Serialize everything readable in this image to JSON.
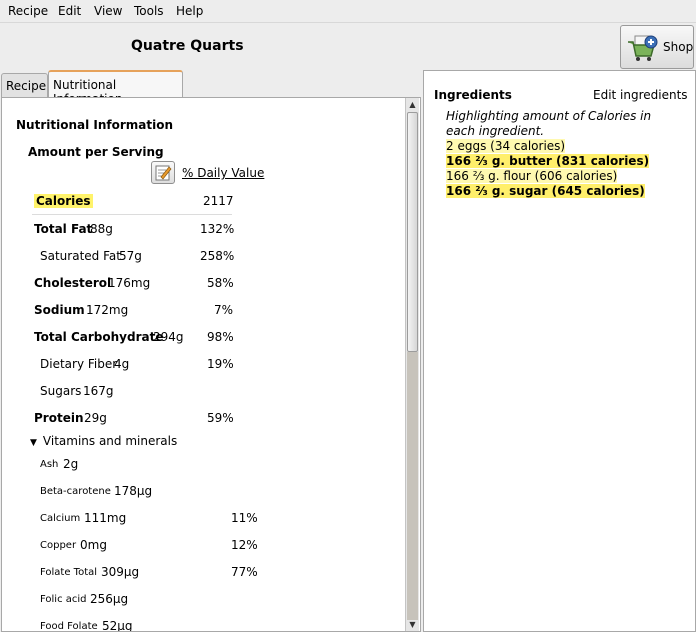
{
  "menubar": {
    "items": [
      "Recipe",
      "Edit",
      "View",
      "Tools",
      "Help"
    ]
  },
  "recipe_title": "Quatre Quarts",
  "shop_button": {
    "label": "Shop",
    "icon": "shopping-cart-icon"
  },
  "tabs": [
    {
      "label": "Recipe",
      "selected": false
    },
    {
      "label": "Nutritional Information",
      "selected": true
    }
  ],
  "nutrition": {
    "heading": "Nutritional Information",
    "amount_label": "Amount per Serving",
    "daily_value_header": "% Daily Value",
    "rows": [
      {
        "name": "Calories",
        "amount": "",
        "dv": "2117"
      },
      {
        "name": "Total Fat",
        "amount": "88g",
        "dv": "132%"
      },
      {
        "name": "Saturated Fat",
        "amount": "57g",
        "dv": "258%"
      },
      {
        "name": "Cholesterol",
        "amount": "176mg",
        "dv": "58%"
      },
      {
        "name": "Sodium",
        "amount": "172mg",
        "dv": "7%"
      },
      {
        "name": "Total Carbohydrate",
        "amount": "294g",
        "dv": "98%"
      },
      {
        "name": "Dietary Fiber",
        "amount": "4g",
        "dv": "19%"
      },
      {
        "name": "Sugars",
        "amount": "167g",
        "dv": ""
      },
      {
        "name": "Protein",
        "amount": "29g",
        "dv": "59%"
      }
    ],
    "vitamins_label": "Vitamins and minerals",
    "vitamins": [
      {
        "name": "Ash",
        "amount": "2g",
        "dv": ""
      },
      {
        "name": "Beta-carotene",
        "amount": "178μg",
        "dv": ""
      },
      {
        "name": "Calcium",
        "amount": "111mg",
        "dv": "11%"
      },
      {
        "name": "Copper",
        "amount": "0mg",
        "dv": "12%"
      },
      {
        "name": "Folate Total",
        "amount": "309μg",
        "dv": "77%"
      },
      {
        "name": "Folic acid",
        "amount": "256μg",
        "dv": ""
      },
      {
        "name": "Food Folate",
        "amount": "52μg",
        "dv": ""
      }
    ]
  },
  "ingredients": {
    "heading": "Ingredients",
    "edit_label": "Edit ingredients",
    "note": "Highlighting amount of Calories in each ingredient.",
    "items": [
      "2 eggs (34 calories)",
      "166 ⅔ g. butter (831 calories)",
      "166 ⅔ g. flour (606 calories)",
      "166 ⅔ g. sugar (645 calories)"
    ]
  },
  "colors": {
    "highlight": "#fff36b",
    "tab_accent": "#e6a25b"
  }
}
